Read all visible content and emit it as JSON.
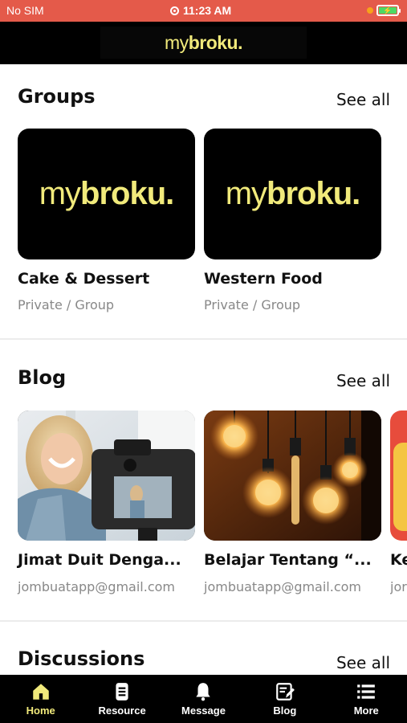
{
  "status_bar": {
    "carrier": "No SIM",
    "time": "11:23 AM"
  },
  "header": {
    "logo_light": "my",
    "logo_bold": "broku."
  },
  "groups": {
    "title": "Groups",
    "see_all": "See all",
    "items": [
      {
        "logo_light": "my",
        "logo_bold": "broku.",
        "name": "Cake & Dessert",
        "meta": "Private / Group"
      },
      {
        "logo_light": "my",
        "logo_bold": "broku.",
        "name": "Western Food",
        "meta": "Private / Group"
      }
    ]
  },
  "blog": {
    "title": "Blog",
    "see_all": "See all",
    "items": [
      {
        "title": "Jimat Duit Denga...",
        "author": "jombuatapp@gmail.com",
        "image": "woman-with-camera-photo"
      },
      {
        "title": "Belajar Tentang “...",
        "author": "jombuatapp@gmail.com",
        "image": "light-bulbs-photo"
      },
      {
        "title": "Ke",
        "author": "jor",
        "image": "partial-card-photo"
      }
    ]
  },
  "discussions": {
    "title": "Discussions",
    "see_all": "See all"
  },
  "bottom_nav": {
    "items": [
      {
        "label": "Home",
        "icon": "home-icon",
        "active": true
      },
      {
        "label": "Resource",
        "icon": "document-icon"
      },
      {
        "label": "Message",
        "icon": "bell-icon"
      },
      {
        "label": "Blog",
        "icon": "edit-icon"
      },
      {
        "label": "More",
        "icon": "menu-icon"
      }
    ]
  },
  "colors": {
    "status_bar": "#e45a4a",
    "brand_yellow": "#f1ea7b",
    "header_bg": "#000000",
    "text_gray": "#888888"
  }
}
